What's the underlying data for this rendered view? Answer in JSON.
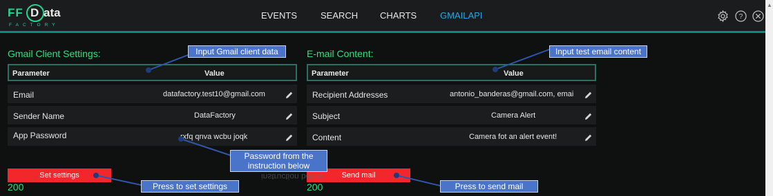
{
  "logo": {
    "ff": "FF",
    "d": "D",
    "ata": "ata",
    "factory": "FACTORY"
  },
  "nav": {
    "events": "EVENTS",
    "search": "SEARCH",
    "charts": "CHARTS",
    "gmailapi": "GMAILAPI",
    "active": "GMAILAPI"
  },
  "header_icons": [
    "gear-icon",
    "help-icon",
    "close-icon"
  ],
  "gmail_settings": {
    "title": "Gmail Client Settings:",
    "col_parameter": "Parameter",
    "col_value": "Value",
    "rows": [
      {
        "label": "Email",
        "value": "datafactory.test10@gmail.com"
      },
      {
        "label": "Sender Name",
        "value": "DataFactory"
      },
      {
        "label": "App Password",
        "value": "rxfq qnva wcbu joqk"
      }
    ],
    "button": "Set settings",
    "status": "200"
  },
  "email_content": {
    "title": "E-mail Content:",
    "col_parameter": "Parameter",
    "col_value": "Value",
    "rows": [
      {
        "label": "Recipient Addresses",
        "value": "antonio_banderas@gmail.com, emai"
      },
      {
        "label": "Subject",
        "value": "Camera Alert"
      },
      {
        "label": "Content",
        "value": "Camera fot an alert event!"
      }
    ],
    "button": "Send mail",
    "status": "200"
  },
  "callouts": {
    "input_client": "Input Gmail client data",
    "input_email": "Input test email content",
    "password_line1": "Password from the",
    "password_line2": "instruction below",
    "password_mirror": "instruction below",
    "press_settings": "Press to set settings",
    "press_send": "Press to send mail"
  },
  "colors": {
    "accent_green": "#2fe07f",
    "teal": "#0e8a7c",
    "active_nav": "#2aa7e1",
    "button_red": "#f2272c",
    "callout_blue": "#4a74c9"
  }
}
